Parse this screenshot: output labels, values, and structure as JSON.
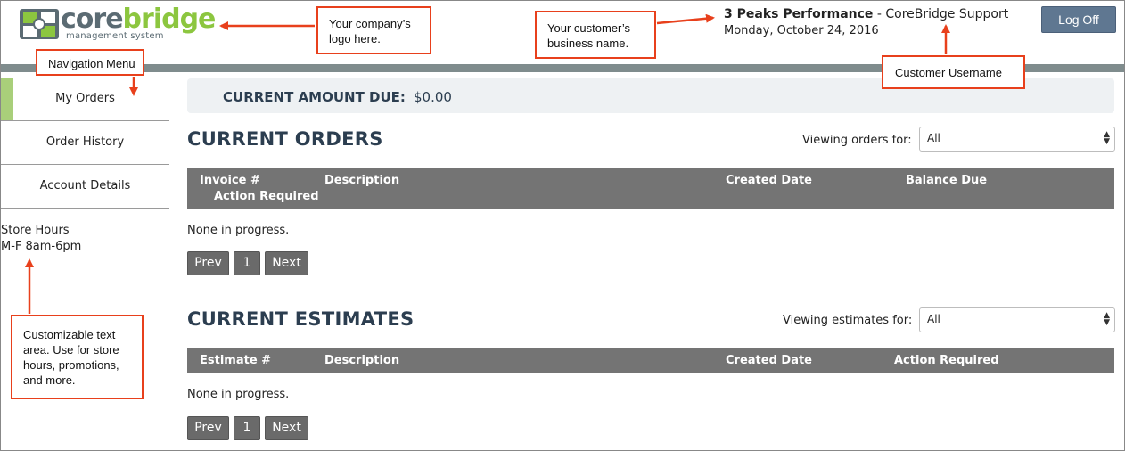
{
  "header": {
    "logo_word_a": "core",
    "logo_word_b": "bridge",
    "logo_subtitle": "management system",
    "business_name": "3 Peaks Performance",
    "user_suffix": " - CoreBridge Support",
    "date": "Monday, October 24, 2016",
    "logoff_label": "Log Off"
  },
  "sidebar": {
    "items": [
      {
        "label": "My Orders"
      },
      {
        "label": "Order History"
      },
      {
        "label": "Account Details"
      }
    ],
    "store_hours_title": "Store Hours",
    "store_hours_value": "M-F 8am-6pm"
  },
  "main": {
    "amount_due_label": "CURRENT AMOUNT DUE:",
    "amount_due_value": "$0.00",
    "orders": {
      "title": "CURRENT ORDERS",
      "viewing_label": "Viewing orders for:",
      "select_value": "All",
      "columns": [
        "Invoice #",
        "Description",
        "Created Date",
        "Balance Due",
        "Action Required"
      ],
      "empty_text": "None in progress.",
      "pager": [
        "Prev",
        "1",
        "Next"
      ]
    },
    "estimates": {
      "title": "CURRENT ESTIMATES",
      "viewing_label": "Viewing estimates for:",
      "select_value": "All",
      "columns": [
        "Estimate #",
        "Description",
        "Created Date",
        "Action Required"
      ],
      "empty_text": "None in progress.",
      "pager": [
        "Prev",
        "1",
        "Next"
      ]
    }
  },
  "callouts": {
    "logo": "Your company’s logo here.",
    "business": "Your customer’s business name.",
    "username": "Customer Username",
    "nav": "Navigation Menu",
    "text_area": "Customizable text area. Use for store hours, promotions, and more."
  },
  "colors": {
    "brand_green": "#8cc63f",
    "brand_grey": "#5b6b73",
    "heading_navy": "#2c3e50",
    "table_header": "#747474",
    "callout_red": "#e8401c",
    "logoff_blue": "#5f7791"
  }
}
